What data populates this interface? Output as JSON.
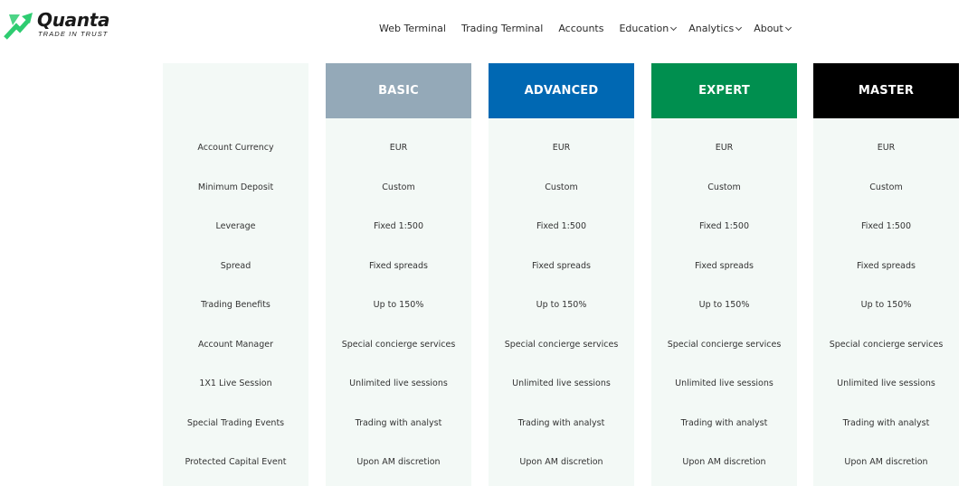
{
  "brand": {
    "name": "Quanta",
    "tagline": "TRADE IN TRUST",
    "accent": "#2ecc71"
  },
  "nav": {
    "items": [
      {
        "label": "Web Terminal",
        "dropdown": false
      },
      {
        "label": "Trading Terminal",
        "dropdown": false
      },
      {
        "label": "Accounts",
        "dropdown": false
      },
      {
        "label": "Education",
        "dropdown": true
      },
      {
        "label": "Analytics",
        "dropdown": true
      },
      {
        "label": "About",
        "dropdown": true
      }
    ]
  },
  "table": {
    "row_labels": [
      "Account Currency",
      "Minimum Deposit",
      "Leverage",
      "Spread",
      "Trading Benefits",
      "Account Manager",
      "1X1 Live Session",
      "Special Trading Events",
      "Protected Capital Event"
    ],
    "plans": [
      {
        "name": "BASIC",
        "color": "#94a9b8",
        "values": [
          "EUR",
          "Custom",
          "Fixed 1:500",
          "Fixed spreads",
          "Up to 150%",
          "Special concierge services",
          "Unlimited live sessions",
          "Trading with analyst",
          "Upon AM discretion"
        ]
      },
      {
        "name": "ADVANCED",
        "color": "#0068b3",
        "values": [
          "EUR",
          "Custom",
          "Fixed 1:500",
          "Fixed spreads",
          "Up to 150%",
          "Special concierge services",
          "Unlimited live sessions",
          "Trading with analyst",
          "Upon AM discretion"
        ]
      },
      {
        "name": "EXPERT",
        "color": "#008f4f",
        "values": [
          "EUR",
          "Custom",
          "Fixed 1:500",
          "Fixed spreads",
          "Up to 150%",
          "Special concierge services",
          "Unlimited live sessions",
          "Trading with analyst",
          "Upon AM discretion"
        ]
      },
      {
        "name": "MASTER",
        "color": "#000000",
        "values": [
          "EUR",
          "Custom",
          "Fixed 1:500",
          "Fixed spreads",
          "Up to 150%",
          "Special concierge services",
          "Unlimited live sessions",
          "Trading with analyst",
          "Upon AM discretion"
        ]
      }
    ]
  }
}
